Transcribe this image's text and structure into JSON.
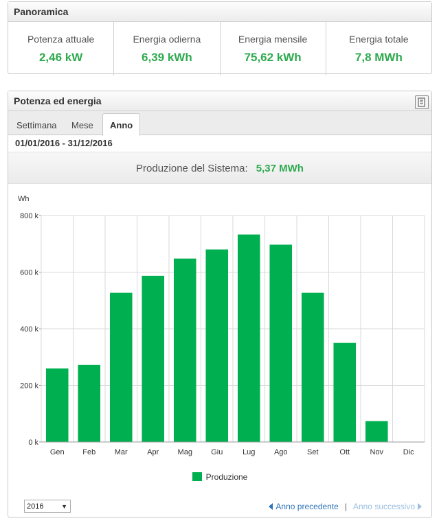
{
  "overview": {
    "title": "Panoramica",
    "cells": [
      {
        "label": "Potenza attuale",
        "value": "2,46 kW"
      },
      {
        "label": "Energia odierna",
        "value": "6,39 kWh"
      },
      {
        "label": "Energia mensile",
        "value": "75,62 kWh"
      },
      {
        "label": "Energia totale",
        "value": "7,8 MWh"
      }
    ]
  },
  "energy": {
    "title": "Potenza ed energia",
    "export_icon": "export-document-icon",
    "tabs": [
      "Settimana",
      "Mese",
      "Anno"
    ],
    "active_tab": "Anno",
    "date_range": "01/01/2016 - 31/12/2016",
    "production_label": "Produzione del Sistema:",
    "production_value": "5,37 MWh",
    "year_select": "2016",
    "prev_link": "Anno precedente",
    "next_link": "Anno successivo",
    "link_separator": "|"
  },
  "colors": {
    "accent_green": "#2eaa4f",
    "bar_green": "#00b050",
    "link_blue": "#2e73b8"
  },
  "chart_data": {
    "type": "bar",
    "ylabel": "Wh",
    "categories": [
      "Gen",
      "Feb",
      "Mar",
      "Apr",
      "Mag",
      "Giu",
      "Lug",
      "Ago",
      "Set",
      "Ott",
      "Nov",
      "Dic"
    ],
    "series": [
      {
        "name": "Produzione",
        "values": [
          260000,
          272000,
          527000,
          587000,
          648000,
          680000,
          733000,
          697000,
          527000,
          350000,
          74000,
          0
        ]
      }
    ],
    "ylim": [
      0,
      800000
    ],
    "yticks": [
      0,
      200000,
      400000,
      600000,
      800000
    ],
    "ytick_labels": [
      "0 k",
      "200 k",
      "400 k",
      "600 k",
      "800 k"
    ],
    "grid": true,
    "legend": "bottom"
  }
}
